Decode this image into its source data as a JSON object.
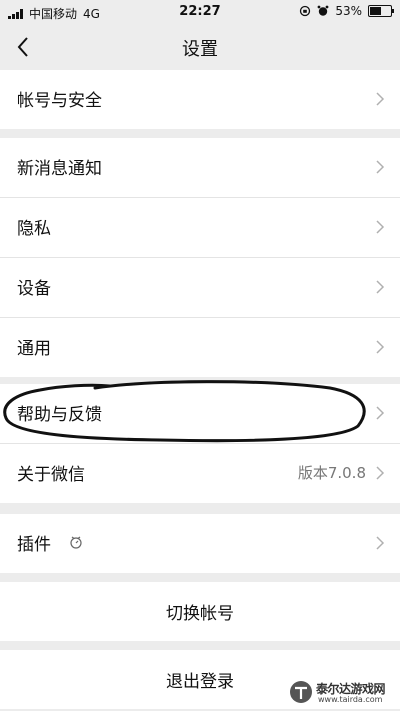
{
  "status_bar": {
    "carrier": "中国移动",
    "network": "4G",
    "time": "22:27",
    "battery_percent": "53%",
    "battery_level": 0.53
  },
  "nav": {
    "title": "设置"
  },
  "groups": {
    "account": {
      "label": "帐号与安全"
    },
    "notify": {
      "label": "新消息通知"
    },
    "privacy": {
      "label": "隐私"
    },
    "device": {
      "label": "设备"
    },
    "general": {
      "label": "通用"
    },
    "help": {
      "label": "帮助与反馈"
    },
    "about": {
      "label": "关于微信",
      "value": "版本7.0.8"
    },
    "plugins": {
      "label": "插件"
    },
    "switch_account": {
      "label": "切换帐号"
    },
    "logout": {
      "label": "退出登录"
    }
  },
  "watermark": {
    "name": "泰尔达游戏网",
    "url": "www.tairda.com"
  },
  "colors": {
    "background": "#ececec",
    "row": "#ffffff",
    "divider": "#e4e4e4",
    "secondary_text": "#777777"
  }
}
